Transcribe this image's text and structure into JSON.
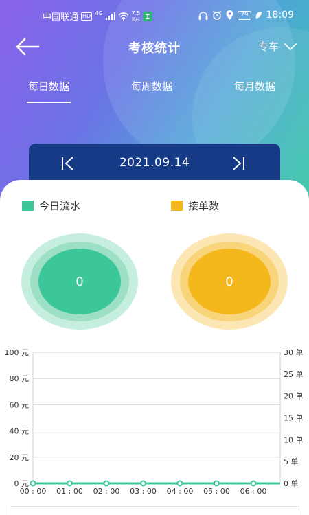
{
  "status_bar": {
    "carrier": "中国联通",
    "hd_badge": "HD",
    "network": "4G",
    "speed_value": "7.5",
    "speed_unit": "K/s",
    "battery": "79",
    "time": "18:09"
  },
  "nav": {
    "title": "考核统计",
    "car_type": "专车"
  },
  "tabs": [
    {
      "label": "每日数据",
      "active": true
    },
    {
      "label": "每周数据",
      "active": false
    },
    {
      "label": "每月数据",
      "active": false
    }
  ],
  "date_bar": {
    "date": "2021.09.14"
  },
  "legend": {
    "revenue_label": "今日流水",
    "orders_label": "接单数"
  },
  "summary": {
    "revenue_value": "0",
    "orders_value": "0"
  },
  "colors": {
    "green": "#3cc79b",
    "yellow": "#f5b81c",
    "navy": "#163a86"
  },
  "chart_data": {
    "type": "line",
    "x": [
      "00 : 00",
      "01 : 00",
      "02 : 00",
      "03 : 00",
      "04 : 00",
      "05 : 00",
      "06 : 00"
    ],
    "series": [
      {
        "name": "",
        "axis": "left",
        "values": [
          0,
          0,
          0,
          0,
          0,
          0,
          0
        ]
      }
    ],
    "y_left": {
      "ticks": [
        "100 元",
        "80 元",
        "60 元",
        "40 元",
        "20 元",
        "0 元"
      ],
      "ylim": [
        0,
        100
      ]
    },
    "y_right": {
      "ticks": [
        "30 单",
        "25 单",
        "20 单",
        "15 单",
        "10 单",
        "5 单",
        "0 单"
      ],
      "ylim": [
        0,
        30
      ]
    },
    "grid": true
  }
}
